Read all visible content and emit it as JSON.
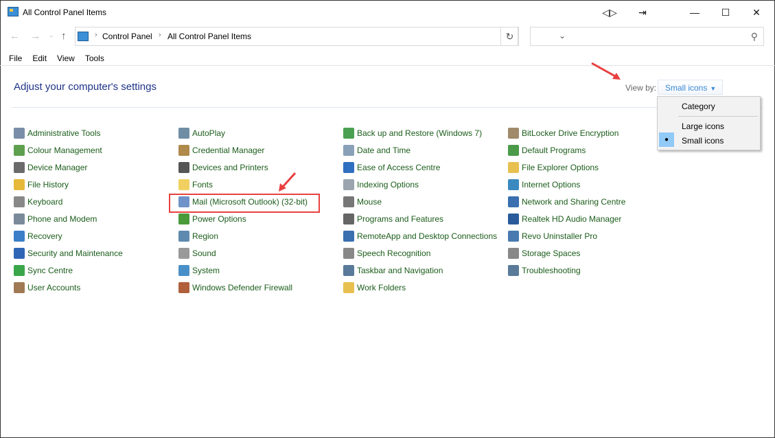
{
  "window": {
    "title": "All Control Panel Items",
    "controls": [
      "snap-icon",
      "share-icon",
      "minimize-icon",
      "maximize-icon",
      "close-icon"
    ]
  },
  "address": {
    "crumbs": [
      "Control Panel",
      "All Control Panel Items"
    ],
    "search_placeholder": ""
  },
  "menu": [
    "File",
    "Edit",
    "View",
    "Tools"
  ],
  "heading": "Adjust your computer's settings",
  "view_by": {
    "label": "View by:",
    "selected": "Small icons",
    "options": [
      "Category",
      "Large icons",
      "Small icons"
    ]
  },
  "accent": "#1a5c1a",
  "columns": [
    [
      {
        "label": "Administrative Tools",
        "color": "#7a8ea8"
      },
      {
        "label": "Colour Management",
        "color": "#5fa04f"
      },
      {
        "label": "Device Manager",
        "color": "#6b6b6b"
      },
      {
        "label": "File History",
        "color": "#e6b93a"
      },
      {
        "label": "Keyboard",
        "color": "#888"
      },
      {
        "label": "Phone and Modem",
        "color": "#7a8a99"
      },
      {
        "label": "Recovery",
        "color": "#3a7fc7"
      },
      {
        "label": "Security and Maintenance",
        "color": "#2f67b5"
      },
      {
        "label": "Sync Centre",
        "color": "#3aa64a"
      },
      {
        "label": "User Accounts",
        "color": "#a07a55"
      }
    ],
    [
      {
        "label": "AutoPlay",
        "color": "#6f8ea5"
      },
      {
        "label": "Credential Manager",
        "color": "#b08a4a"
      },
      {
        "label": "Devices and Printers",
        "color": "#555"
      },
      {
        "label": "Fonts",
        "color": "#f0d060"
      },
      {
        "label": "Mail (Microsoft Outlook) (32-bit)",
        "color": "#6f93c8"
      },
      {
        "label": "Power Options",
        "color": "#4a9a3a"
      },
      {
        "label": "Region",
        "color": "#5f8ab0"
      },
      {
        "label": "Sound",
        "color": "#999"
      },
      {
        "label": "System",
        "color": "#4a90c8"
      },
      {
        "label": "Windows Defender Firewall",
        "color": "#b0603a"
      }
    ],
    [
      {
        "label": "Back up and Restore (Windows 7)",
        "color": "#4aa050"
      },
      {
        "label": "Date and Time",
        "color": "#8aa0b8"
      },
      {
        "label": "Ease of Access Centre",
        "color": "#2f6fc0"
      },
      {
        "label": "Indexing Options",
        "color": "#9aa5b0"
      },
      {
        "label": "Mouse",
        "color": "#777"
      },
      {
        "label": "Programs and Features",
        "color": "#666"
      },
      {
        "label": "RemoteApp and Desktop Connections",
        "color": "#3a6fb0"
      },
      {
        "label": "Speech Recognition",
        "color": "#888"
      },
      {
        "label": "Taskbar and Navigation",
        "color": "#5a7a9a"
      },
      {
        "label": "Work Folders",
        "color": "#e8c050"
      }
    ],
    [
      {
        "label": "BitLocker Drive Encryption",
        "color": "#a08a6a"
      },
      {
        "label": "Default Programs",
        "color": "#4a9a4a"
      },
      {
        "label": "File Explorer Options",
        "color": "#e8c050"
      },
      {
        "label": "Internet Options",
        "color": "#3a8ac0"
      },
      {
        "label": "Network and Sharing Centre",
        "color": "#3a70b0"
      },
      {
        "label": "Realtek HD Audio Manager",
        "color": "#2a5a9a"
      },
      {
        "label": "Revo Uninstaller Pro",
        "color": "#4a7ab0"
      },
      {
        "label": "Storage Spaces",
        "color": "#888"
      },
      {
        "label": "Troubleshooting",
        "color": "#5a7a9a"
      }
    ]
  ]
}
